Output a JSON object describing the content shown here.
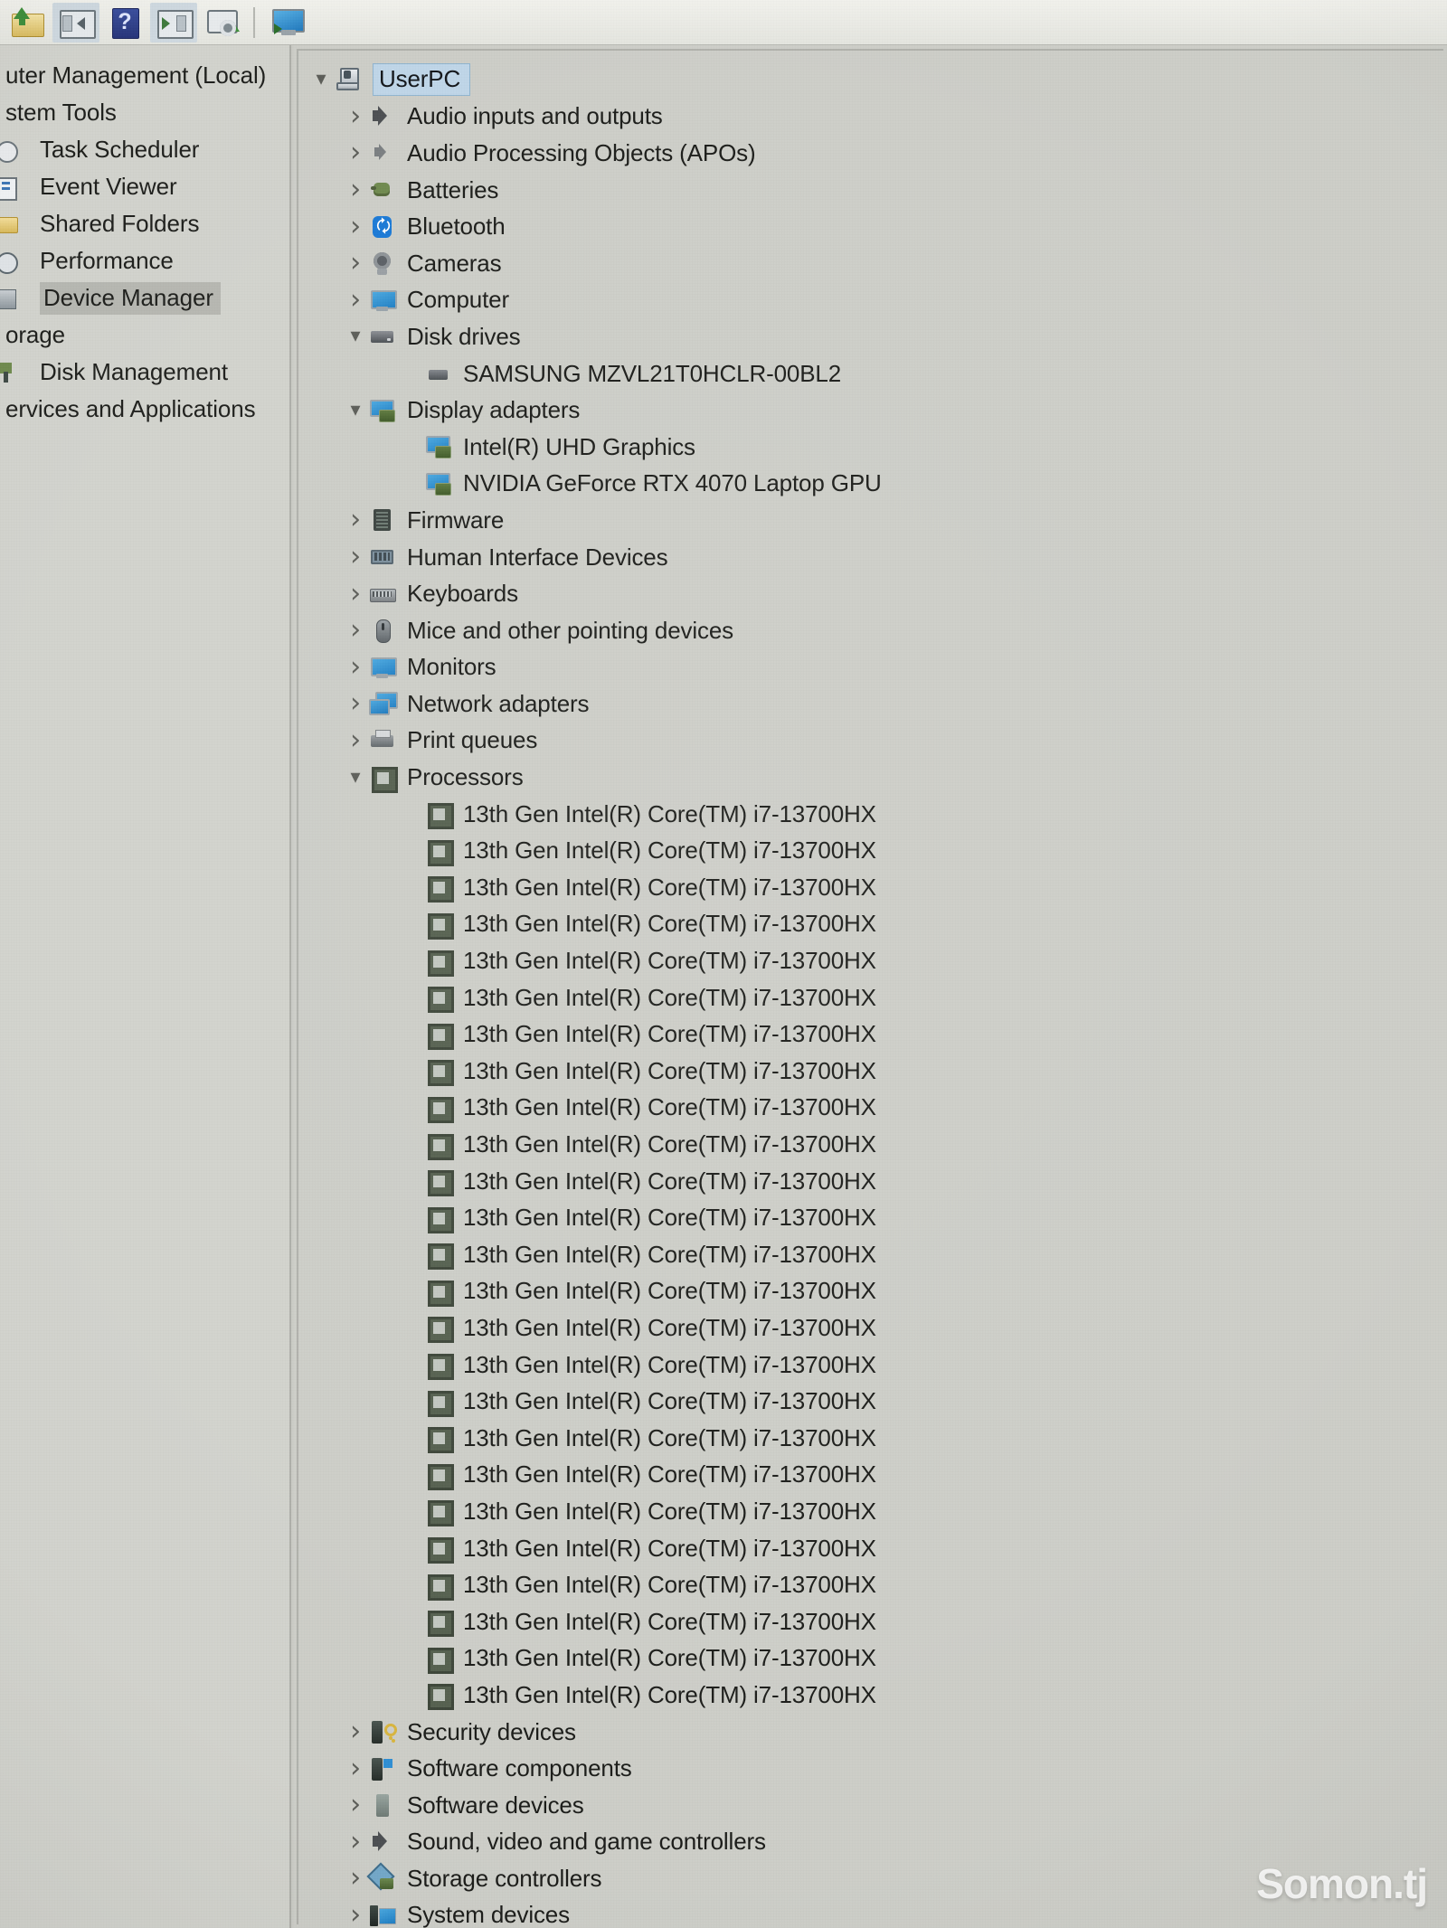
{
  "window": {
    "app": "Computer Management",
    "watermark": "Somon.tj"
  },
  "toolbar": {
    "buttons": [
      {
        "name": "up-one-level-button",
        "label": "Up One Level",
        "icon": "folder-up-icon",
        "lit": false
      },
      {
        "name": "show-hide-console-tree-button",
        "label": "Show/Hide Console Tree",
        "icon": "console-tree-icon",
        "lit": true
      },
      {
        "name": "help-button",
        "label": "Help",
        "icon": "question-mark-icon",
        "lit": false
      },
      {
        "name": "properties-button",
        "label": "Properties",
        "icon": "properties-pane-icon",
        "lit": true
      },
      {
        "name": "scan-hardware-changes-button",
        "label": "Scan for hardware changes",
        "icon": "scan-hardware-icon",
        "lit": false
      },
      {
        "name": "view-devices-button",
        "label": "View devices",
        "icon": "monitor-icon",
        "lit": false
      }
    ]
  },
  "console_tree": {
    "items": [
      {
        "label": "uter Management (Local)",
        "full_label": "Computer Management (Local)",
        "icon": "none",
        "indent": 0,
        "selected": false
      },
      {
        "label": "stem Tools",
        "full_label": "System Tools",
        "icon": "none",
        "indent": 0,
        "selected": false
      },
      {
        "label": "Task Scheduler",
        "full_label": "Task Scheduler",
        "icon": "clock-icon",
        "indent": 1,
        "selected": false
      },
      {
        "label": "Event Viewer",
        "full_label": "Event Viewer",
        "icon": "event-log-icon",
        "indent": 1,
        "selected": false
      },
      {
        "label": "Shared Folders",
        "full_label": "Shared Folders",
        "icon": "folder-icon",
        "indent": 1,
        "selected": false
      },
      {
        "label": "Performance",
        "full_label": "Performance",
        "icon": "performance-gauge-icon",
        "indent": 1,
        "selected": false
      },
      {
        "label": "Device Manager",
        "full_label": "Device Manager",
        "icon": "device-manager-icon",
        "indent": 1,
        "selected": true
      },
      {
        "label": "orage",
        "full_label": "Storage",
        "icon": "none",
        "indent": 0,
        "selected": false
      },
      {
        "label": "Disk Management",
        "full_label": "Disk Management",
        "icon": "disk-management-icon",
        "indent": 1,
        "selected": false
      },
      {
        "label": "ervices and Applications",
        "full_label": "Services and Applications",
        "icon": "none",
        "indent": 0,
        "selected": false
      }
    ]
  },
  "device_tree": {
    "root": {
      "label": "UserPC",
      "icon": "computer-node-icon",
      "expander": "chevron-down",
      "selected": true
    },
    "nodes": [
      {
        "label": "Audio inputs and outputs",
        "icon": "speaker-icon",
        "expander": "chevron-right",
        "indent": 1
      },
      {
        "label": "Audio Processing Objects (APOs)",
        "icon": "speaker-dim-icon",
        "expander": "chevron-right",
        "indent": 1
      },
      {
        "label": "Batteries",
        "icon": "battery-icon",
        "expander": "chevron-right",
        "indent": 1
      },
      {
        "label": "Bluetooth",
        "icon": "bluetooth-icon",
        "expander": "chevron-right",
        "indent": 1
      },
      {
        "label": "Cameras",
        "icon": "camera-icon",
        "expander": "chevron-right",
        "indent": 1
      },
      {
        "label": "Computer",
        "icon": "monitor-icon",
        "expander": "chevron-right",
        "indent": 1
      },
      {
        "label": "Disk drives",
        "icon": "disk-drive-icon",
        "expander": "chevron-down",
        "indent": 1
      },
      {
        "label": "SAMSUNG MZVL21T0HCLR-00BL2",
        "icon": "disk-drive-small-icon",
        "expander": "none",
        "indent": 2
      },
      {
        "label": "Display adapters",
        "icon": "display-adapter-icon",
        "expander": "chevron-down",
        "indent": 1
      },
      {
        "label": "Intel(R) UHD Graphics",
        "icon": "display-adapter-icon",
        "expander": "none",
        "indent": 2
      },
      {
        "label": "NVIDIA GeForce RTX 4070 Laptop GPU",
        "icon": "display-adapter-icon",
        "expander": "none",
        "indent": 2
      },
      {
        "label": "Firmware",
        "icon": "firmware-chip-icon",
        "expander": "chevron-right",
        "indent": 1
      },
      {
        "label": "Human Interface Devices",
        "icon": "hid-icon",
        "expander": "chevron-right",
        "indent": 1
      },
      {
        "label": "Keyboards",
        "icon": "keyboard-icon",
        "expander": "chevron-right",
        "indent": 1
      },
      {
        "label": "Mice and other pointing devices",
        "icon": "mouse-icon",
        "expander": "chevron-right",
        "indent": 1
      },
      {
        "label": "Monitors",
        "icon": "monitor-icon",
        "expander": "chevron-right",
        "indent": 1
      },
      {
        "label": "Network adapters",
        "icon": "network-adapter-icon",
        "expander": "chevron-right",
        "indent": 1
      },
      {
        "label": "Print queues",
        "icon": "printer-icon",
        "expander": "chevron-right",
        "indent": 1
      },
      {
        "label": "Processors",
        "icon": "processor-icon",
        "expander": "chevron-down",
        "indent": 1
      },
      {
        "label": "13th Gen Intel(R) Core(TM) i7-13700HX",
        "icon": "processor-icon",
        "expander": "none",
        "indent": 2
      },
      {
        "label": "13th Gen Intel(R) Core(TM) i7-13700HX",
        "icon": "processor-icon",
        "expander": "none",
        "indent": 2
      },
      {
        "label": "13th Gen Intel(R) Core(TM) i7-13700HX",
        "icon": "processor-icon",
        "expander": "none",
        "indent": 2
      },
      {
        "label": "13th Gen Intel(R) Core(TM) i7-13700HX",
        "icon": "processor-icon",
        "expander": "none",
        "indent": 2
      },
      {
        "label": "13th Gen Intel(R) Core(TM) i7-13700HX",
        "icon": "processor-icon",
        "expander": "none",
        "indent": 2
      },
      {
        "label": "13th Gen Intel(R) Core(TM) i7-13700HX",
        "icon": "processor-icon",
        "expander": "none",
        "indent": 2
      },
      {
        "label": "13th Gen Intel(R) Core(TM) i7-13700HX",
        "icon": "processor-icon",
        "expander": "none",
        "indent": 2
      },
      {
        "label": "13th Gen Intel(R) Core(TM) i7-13700HX",
        "icon": "processor-icon",
        "expander": "none",
        "indent": 2
      },
      {
        "label": "13th Gen Intel(R) Core(TM) i7-13700HX",
        "icon": "processor-icon",
        "expander": "none",
        "indent": 2
      },
      {
        "label": "13th Gen Intel(R) Core(TM) i7-13700HX",
        "icon": "processor-icon",
        "expander": "none",
        "indent": 2
      },
      {
        "label": "13th Gen Intel(R) Core(TM) i7-13700HX",
        "icon": "processor-icon",
        "expander": "none",
        "indent": 2
      },
      {
        "label": "13th Gen Intel(R) Core(TM) i7-13700HX",
        "icon": "processor-icon",
        "expander": "none",
        "indent": 2
      },
      {
        "label": "13th Gen Intel(R) Core(TM) i7-13700HX",
        "icon": "processor-icon",
        "expander": "none",
        "indent": 2
      },
      {
        "label": "13th Gen Intel(R) Core(TM) i7-13700HX",
        "icon": "processor-icon",
        "expander": "none",
        "indent": 2
      },
      {
        "label": "13th Gen Intel(R) Core(TM) i7-13700HX",
        "icon": "processor-icon",
        "expander": "none",
        "indent": 2
      },
      {
        "label": "13th Gen Intel(R) Core(TM) i7-13700HX",
        "icon": "processor-icon",
        "expander": "none",
        "indent": 2
      },
      {
        "label": "13th Gen Intel(R) Core(TM) i7-13700HX",
        "icon": "processor-icon",
        "expander": "none",
        "indent": 2
      },
      {
        "label": "13th Gen Intel(R) Core(TM) i7-13700HX",
        "icon": "processor-icon",
        "expander": "none",
        "indent": 2
      },
      {
        "label": "13th Gen Intel(R) Core(TM) i7-13700HX",
        "icon": "processor-icon",
        "expander": "none",
        "indent": 2
      },
      {
        "label": "13th Gen Intel(R) Core(TM) i7-13700HX",
        "icon": "processor-icon",
        "expander": "none",
        "indent": 2
      },
      {
        "label": "13th Gen Intel(R) Core(TM) i7-13700HX",
        "icon": "processor-icon",
        "expander": "none",
        "indent": 2
      },
      {
        "label": "13th Gen Intel(R) Core(TM) i7-13700HX",
        "icon": "processor-icon",
        "expander": "none",
        "indent": 2
      },
      {
        "label": "13th Gen Intel(R) Core(TM) i7-13700HX",
        "icon": "processor-icon",
        "expander": "none",
        "indent": 2
      },
      {
        "label": "13th Gen Intel(R) Core(TM) i7-13700HX",
        "icon": "processor-icon",
        "expander": "none",
        "indent": 2
      },
      {
        "label": "13th Gen Intel(R) Core(TM) i7-13700HX",
        "icon": "processor-icon",
        "expander": "none",
        "indent": 2
      },
      {
        "label": "Security devices",
        "icon": "security-device-icon",
        "expander": "chevron-right",
        "indent": 1
      },
      {
        "label": "Software components",
        "icon": "software-component-icon",
        "expander": "chevron-right",
        "indent": 1
      },
      {
        "label": "Software devices",
        "icon": "software-device-icon",
        "expander": "chevron-right",
        "indent": 1
      },
      {
        "label": "Sound, video and game controllers",
        "icon": "speaker-icon",
        "expander": "chevron-right",
        "indent": 1
      },
      {
        "label": "Storage controllers",
        "icon": "storage-controller-icon",
        "expander": "chevron-right",
        "indent": 1
      },
      {
        "label": "System devices",
        "icon": "system-device-icon",
        "expander": "chevron-right",
        "indent": 1
      }
    ]
  },
  "colors": {
    "window_bg": "#cdcec8",
    "tree_bg": "#d2d3cd",
    "selection_blue": "#bfd6e8",
    "selection_gray": "#b6b7b1",
    "text": "#1b1c19"
  }
}
